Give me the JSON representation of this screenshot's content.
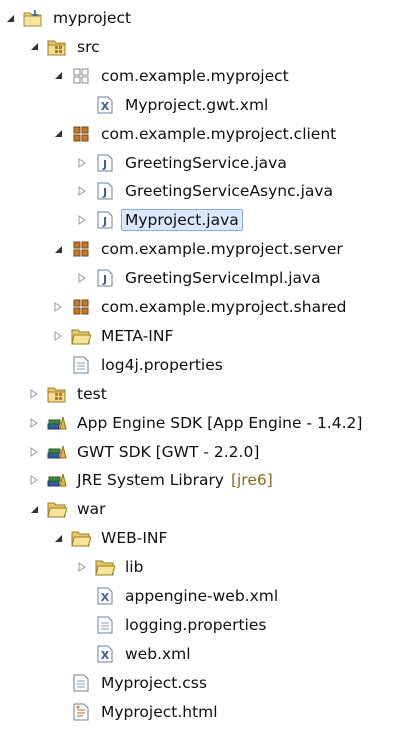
{
  "tree": [
    {
      "label": "myproject",
      "icon": "project-icon",
      "depth": 0,
      "expanded": true
    },
    {
      "label": "src",
      "icon": "source-folder-icon",
      "depth": 1,
      "expanded": true
    },
    {
      "label": "com.example.myproject",
      "icon": "package-empty-icon",
      "depth": 2,
      "expanded": true
    },
    {
      "label": "Myproject.gwt.xml",
      "icon": "xml-file-icon",
      "depth": 3,
      "expanded": null
    },
    {
      "label": "com.example.myproject.client",
      "icon": "package-icon",
      "depth": 2,
      "expanded": true
    },
    {
      "label": "GreetingService.java",
      "icon": "java-file-icon",
      "depth": 3,
      "expanded": false
    },
    {
      "label": "GreetingServiceAsync.java",
      "icon": "java-file-icon",
      "depth": 3,
      "expanded": false
    },
    {
      "label": "Myproject.java",
      "icon": "java-file-icon",
      "depth": 3,
      "expanded": false,
      "selected": true
    },
    {
      "label": "com.example.myproject.server",
      "icon": "package-icon",
      "depth": 2,
      "expanded": true
    },
    {
      "label": "GreetingServiceImpl.java",
      "icon": "java-file-icon",
      "depth": 3,
      "expanded": false
    },
    {
      "label": "com.example.myproject.shared",
      "icon": "package-icon",
      "depth": 2,
      "expanded": false
    },
    {
      "label": "META-INF",
      "icon": "folder-icon",
      "depth": 2,
      "expanded": false
    },
    {
      "label": "log4j.properties",
      "icon": "text-file-icon",
      "depth": 2,
      "expanded": null
    },
    {
      "label": "test",
      "icon": "source-folder-icon",
      "depth": 1,
      "expanded": false
    },
    {
      "label": "App Engine SDK [App Engine - 1.4.2]",
      "icon": "library-icon",
      "depth": 1,
      "expanded": false
    },
    {
      "label": "GWT SDK [GWT - 2.2.0]",
      "icon": "library-icon",
      "depth": 1,
      "expanded": false
    },
    {
      "label": "JRE System Library",
      "icon": "library-icon",
      "depth": 1,
      "expanded": false,
      "decoration": "[jre6]"
    },
    {
      "label": "war",
      "icon": "folder-icon",
      "depth": 1,
      "expanded": true
    },
    {
      "label": "WEB-INF",
      "icon": "folder-icon",
      "depth": 2,
      "expanded": true
    },
    {
      "label": "lib",
      "icon": "folder-icon",
      "depth": 3,
      "expanded": false
    },
    {
      "label": "appengine-web.xml",
      "icon": "xml-file-icon",
      "depth": 3,
      "expanded": null
    },
    {
      "label": "logging.properties",
      "icon": "text-file-icon",
      "depth": 3,
      "expanded": null
    },
    {
      "label": "web.xml",
      "icon": "xml-file-icon",
      "depth": 3,
      "expanded": null
    },
    {
      "label": "Myproject.css",
      "icon": "text-file-icon",
      "depth": 2,
      "expanded": null
    },
    {
      "label": "Myproject.html",
      "icon": "html-file-icon",
      "depth": 2,
      "expanded": null
    }
  ],
  "colors": {
    "selection_bg": "#d9e8fb",
    "selection_border": "#84acdd",
    "decoration": "#8a6d1e",
    "folder": "#e8c766",
    "package": "#b8742c",
    "java": "#4a6fa8"
  }
}
